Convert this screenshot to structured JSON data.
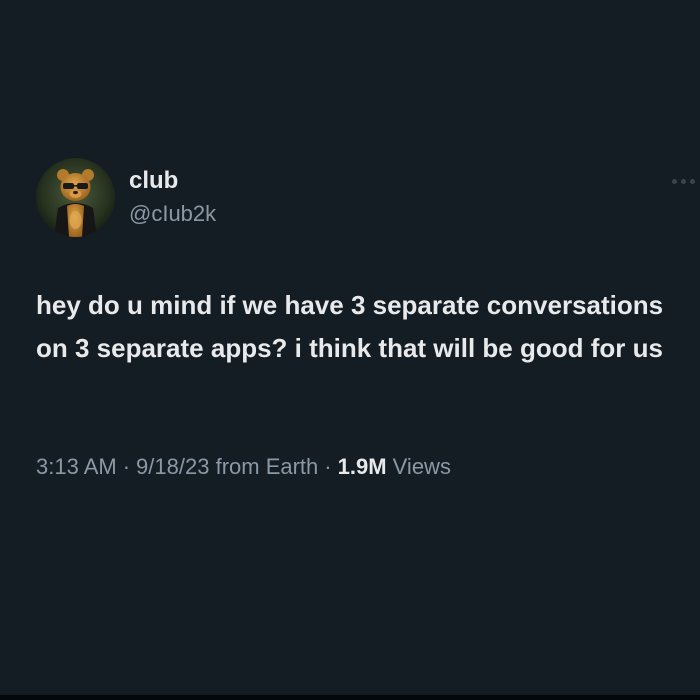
{
  "tweet": {
    "author": {
      "display_name": "club",
      "handle": "@cIub2k",
      "avatar_icon": "bear-avatar-icon"
    },
    "more_icon": "more-dots-icon",
    "text": "hey do u mind if we have 3 separate conversations on 3 separate apps? i think that will be good for us",
    "meta": {
      "time": "3:13 AM",
      "separator": "·",
      "date": "9/18/23",
      "source": "from Earth",
      "view_count": "1.9M",
      "views_label": "Views"
    }
  },
  "colors": {
    "background": "#141c24",
    "primary_text": "#e7e9ea",
    "secondary_text": "#8b98a5"
  }
}
